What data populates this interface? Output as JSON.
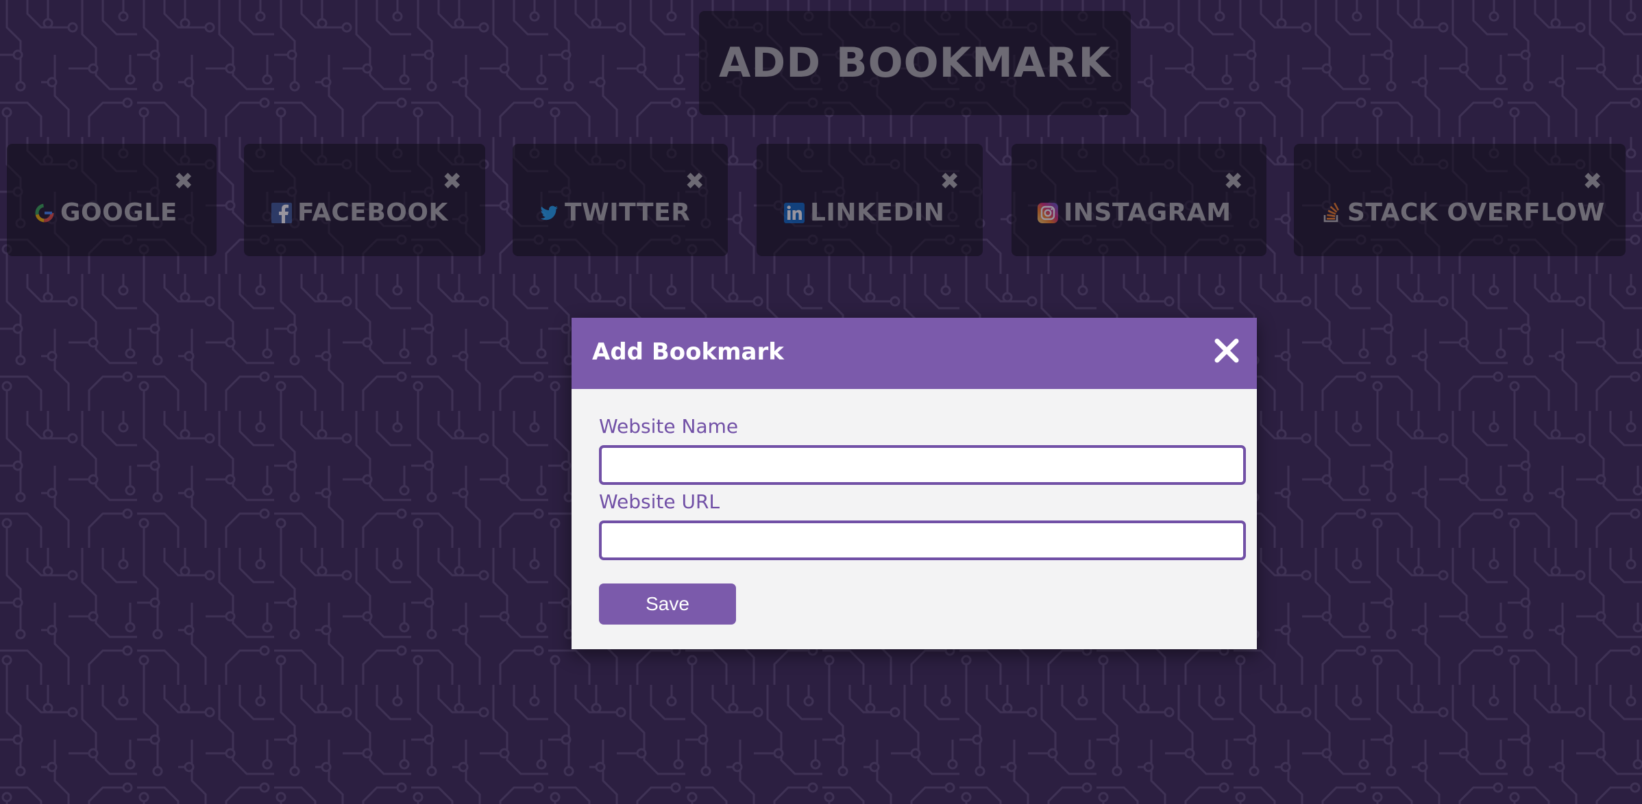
{
  "header": {
    "add_bookmark_label": "ADD BOOKMARK"
  },
  "bookmarks": [
    {
      "name": "GOOGLE",
      "icon": "google-icon"
    },
    {
      "name": "FACEBOOK",
      "icon": "facebook-icon"
    },
    {
      "name": "TWITTER",
      "icon": "twitter-icon"
    },
    {
      "name": "LINKEDIN",
      "icon": "linkedin-icon"
    },
    {
      "name": "INSTAGRAM",
      "icon": "instagram-icon"
    },
    {
      "name": "STACK OVERFLOW",
      "icon": "stack-overflow-icon"
    }
  ],
  "bookmark_close_glyph": "✖",
  "modal": {
    "title": "Add Bookmark",
    "website_name_label": "Website Name",
    "website_name_value": "",
    "website_url_label": "Website URL",
    "website_url_value": "",
    "save_label": "Save"
  },
  "colors": {
    "background": "#3a2a55",
    "circuit_lines": "#5a4a74",
    "modal_header": "#7b5aab",
    "accent": "#7150a6",
    "modal_body": "#f3f3f4",
    "dim_text": "#6d6a74"
  }
}
